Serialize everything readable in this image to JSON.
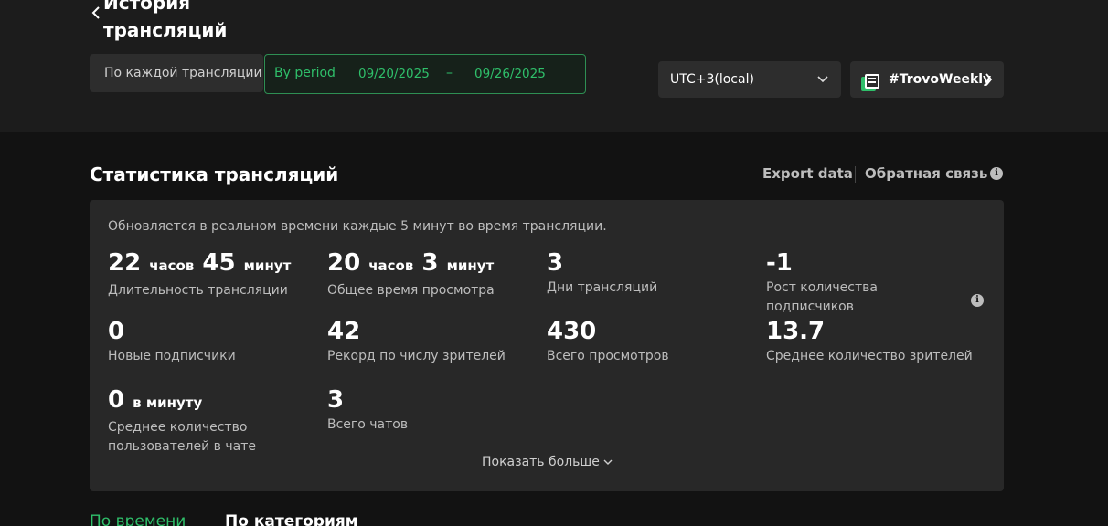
{
  "header": {
    "title": "История трансляций",
    "mode_per_stream": "По каждой трансляции",
    "period_label": "By period",
    "date_from": "09/20/2025",
    "date_separator": "–",
    "date_to": "09/26/2025",
    "timezone": "UTC+3(local)",
    "hashtag": "#TrovoWeekly"
  },
  "section": {
    "title": "Статистика трансляций",
    "export": "Export data",
    "feedback": "Обратная связь"
  },
  "stats": {
    "note": "Обновляется в реальном времени каждые 5 минут во время трансляции.",
    "items": [
      {
        "v1": "22",
        "u1": "часов",
        "v2": "45",
        "u2": "минут",
        "label": "Длительность трансляции"
      },
      {
        "v1": "20",
        "u1": "часов",
        "v2": "3",
        "u2": "минут",
        "label": "Общее время просмотра"
      },
      {
        "v1": "3",
        "label": "Дни трансляций"
      },
      {
        "v1": "-1",
        "label": "Рост количества подписчиков"
      },
      {
        "v1": "0",
        "label": "Новые подписчики"
      },
      {
        "v1": "42",
        "label": "Рекорд по числу зрителей"
      },
      {
        "v1": "430",
        "label": "Всего просмотров"
      },
      {
        "v1": "13.7",
        "label": "Среднее количество зрителей"
      },
      {
        "v1": "0",
        "u1": "в минуту",
        "label": "Среднее количество пользователей в чате"
      },
      {
        "v1": "3",
        "label": "Всего чатов"
      }
    ],
    "show_more": "Показать больше"
  },
  "tabs": {
    "by_time": "По времени",
    "by_category": "По категориям"
  },
  "colors": {
    "accent": "#2fbf6a",
    "card": "#282828",
    "background": "#121212"
  }
}
